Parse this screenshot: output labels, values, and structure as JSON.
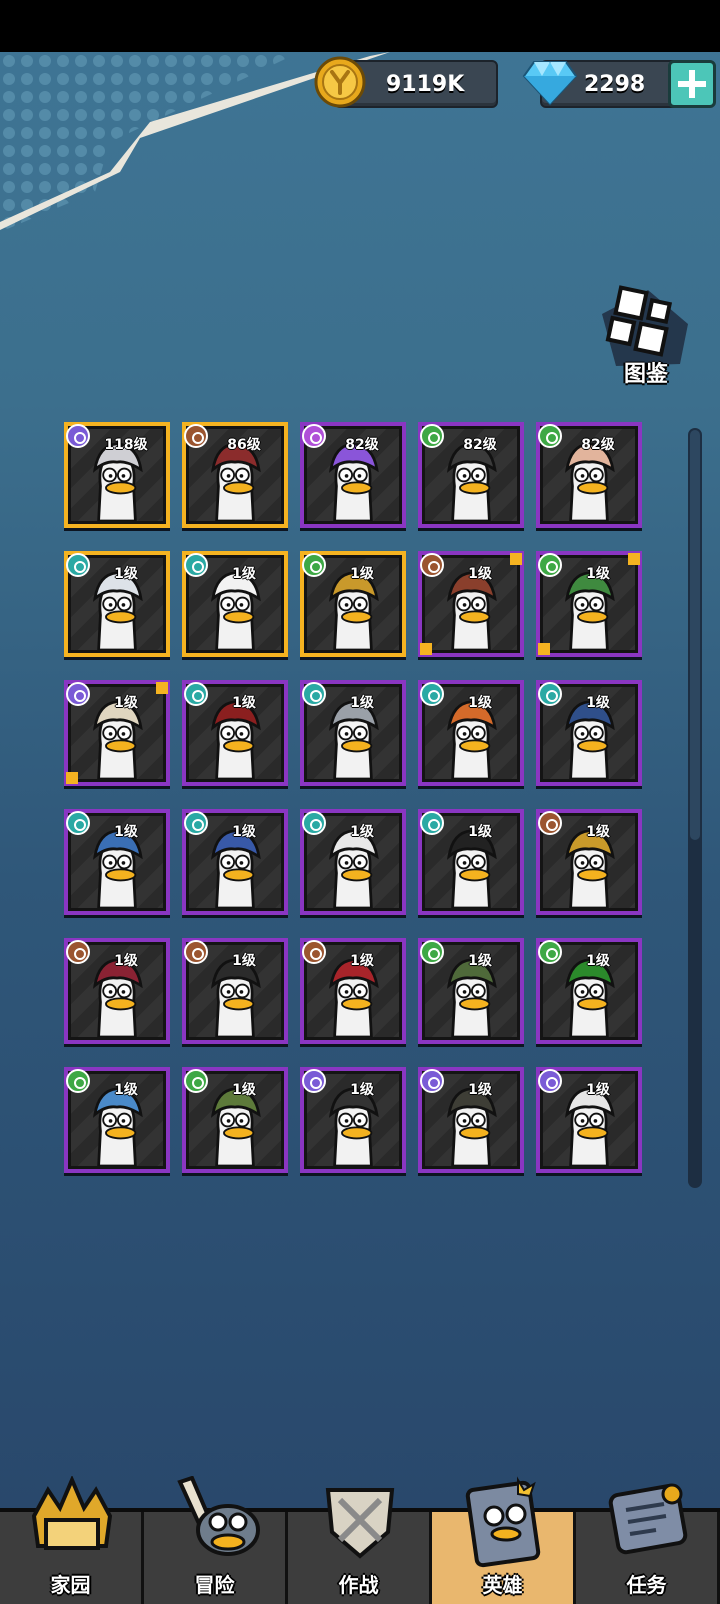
{
  "currency": {
    "gold": "9119K",
    "gems": "2298"
  },
  "codex": {
    "label": "图鉴"
  },
  "heroes": [
    {
      "level": "118级",
      "frame": "gold",
      "element": "purple"
    },
    {
      "level": "86级",
      "frame": "gold",
      "element": "brown"
    },
    {
      "level": "82级",
      "frame": "purple",
      "element": "pink"
    },
    {
      "level": "82级",
      "frame": "purple",
      "element": "green"
    },
    {
      "level": "82级",
      "frame": "purple",
      "element": "green"
    },
    {
      "level": "1级",
      "frame": "gold",
      "element": "teal"
    },
    {
      "level": "1级",
      "frame": "gold",
      "element": "teal"
    },
    {
      "level": "1级",
      "frame": "gold",
      "element": "green"
    },
    {
      "level": "1级",
      "frame": "purple",
      "element": "brown"
    },
    {
      "level": "1级",
      "frame": "purple",
      "element": "green"
    },
    {
      "level": "1级",
      "frame": "purple",
      "element": "purple"
    },
    {
      "level": "1级",
      "frame": "purple",
      "element": "teal"
    },
    {
      "level": "1级",
      "frame": "purple",
      "element": "teal"
    },
    {
      "level": "1级",
      "frame": "purple",
      "element": "teal"
    },
    {
      "level": "1级",
      "frame": "purple",
      "element": "teal"
    },
    {
      "level": "1级",
      "frame": "purple",
      "element": "teal"
    },
    {
      "level": "1级",
      "frame": "purple",
      "element": "teal"
    },
    {
      "level": "1级",
      "frame": "purple",
      "element": "teal"
    },
    {
      "level": "1级",
      "frame": "purple",
      "element": "teal"
    },
    {
      "level": "1级",
      "frame": "purple",
      "element": "brown"
    },
    {
      "level": "1级",
      "frame": "purple",
      "element": "brown"
    },
    {
      "level": "1级",
      "frame": "purple",
      "element": "brown"
    },
    {
      "level": "1级",
      "frame": "purple",
      "element": "brown"
    },
    {
      "level": "1级",
      "frame": "purple",
      "element": "green"
    },
    {
      "level": "1级",
      "frame": "purple",
      "element": "green"
    },
    {
      "level": "1级",
      "frame": "purple",
      "element": "green"
    },
    {
      "level": "1级",
      "frame": "purple",
      "element": "green"
    },
    {
      "level": "1级",
      "frame": "purple",
      "element": "purple"
    },
    {
      "level": "1级",
      "frame": "purple",
      "element": "purple"
    },
    {
      "level": "1级",
      "frame": "purple",
      "element": "purple"
    }
  ],
  "nav": {
    "tabs": [
      {
        "label": "家园",
        "icon": "home-castle-icon"
      },
      {
        "label": "冒险",
        "icon": "adventure-sword-icon"
      },
      {
        "label": "作战",
        "icon": "battle-shield-icon"
      },
      {
        "label": "英雄",
        "icon": "hero-book-icon",
        "active": true
      },
      {
        "label": "任务",
        "icon": "quest-scroll-icon"
      }
    ]
  },
  "colors": {
    "legendary_frame": "#f5b321",
    "epic_frame": "#8a36c2",
    "active_tab": "#e9b76e"
  }
}
